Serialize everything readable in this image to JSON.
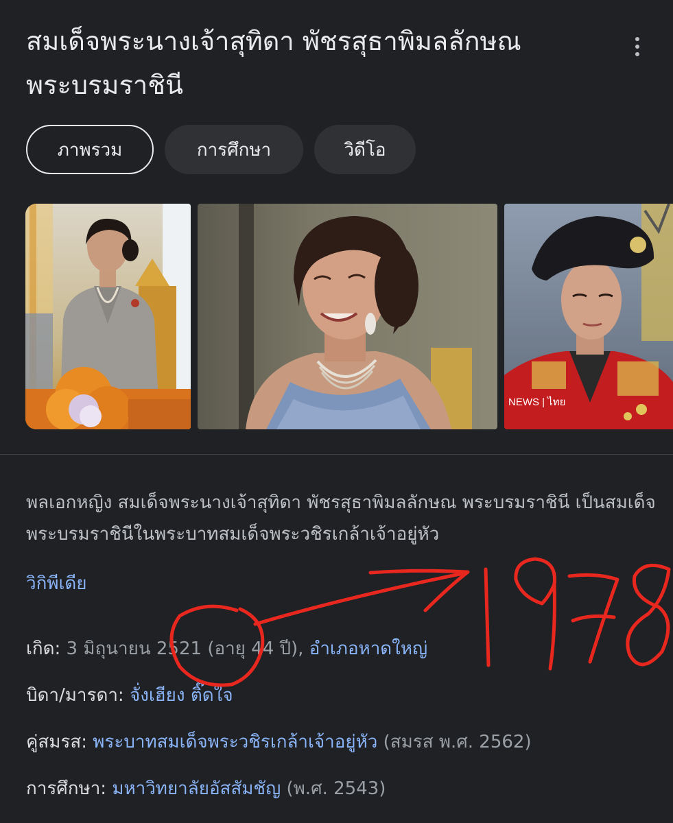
{
  "header": {
    "title": "สมเด็จพระนางเจ้าสุทิดา พัชรสุธาพิมลลักษณ พระบรมราชินี",
    "more_icon": "more-vert-icon"
  },
  "tabs": [
    {
      "label": "ภาพรวม",
      "active": true
    },
    {
      "label": "การศึกษา",
      "active": false
    },
    {
      "label": "วิดีโอ",
      "active": false
    }
  ],
  "images": {
    "third_image_watermark": "NEWS | ไทย"
  },
  "description": {
    "text": "พลเอกหญิง สมเด็จพระนางเจ้าสุทิดา พัชรสุธาพิมลลักษณ พระบรมราชินี เป็นสมเด็จพระบรมราชินีในพระบาทสมเด็จพระวชิรเกล้าเจ้าอยู่หัว",
    "source_link": "วิกิพีเดีย"
  },
  "facts": {
    "born": {
      "label": "เกิด:",
      "value": "3 มิถุนายน 2521 (อายุ 44 ปี),",
      "link": "อำเภอหาดใหญ่"
    },
    "parents": {
      "label": "บิดา/มารดา:",
      "link": "จั่งเฮียง ติ๊ดใจ"
    },
    "spouse": {
      "label": "คู่สมรส:",
      "link": "พระบาทสมเด็จพระวชิรเกล้าเจ้าอยู่หัว",
      "value": "(สมรส พ.ศ. 2562)"
    },
    "education": {
      "label": "การศึกษา:",
      "link": "มหาวิทยาลัยอัสสัมชัญ",
      "value": "(พ.ศ. 2543)"
    }
  },
  "annotation": {
    "handwritten_text": "1978",
    "color": "#e8271f"
  },
  "colors": {
    "background": "#202124",
    "link": "#8ab4f8",
    "text": "#bdc1c6"
  }
}
